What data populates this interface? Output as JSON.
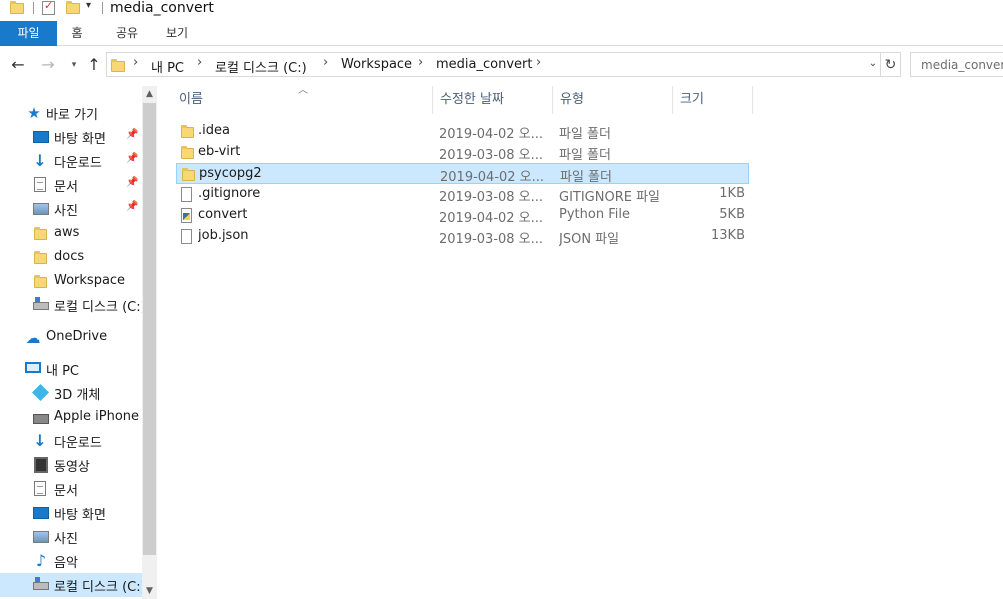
{
  "window": {
    "title": "media_convert"
  },
  "ribbon": {
    "tabs": [
      "파일",
      "홈",
      "공유",
      "보기"
    ]
  },
  "address": {
    "crumbs": [
      "내 PC",
      "로컬 디스크 (C:)",
      "Workspace",
      "media_convert"
    ]
  },
  "search": {
    "placeholder": "media_convert 검색"
  },
  "sidebar": {
    "items": [
      {
        "label": "바로 가기",
        "icon": "star-icon"
      },
      {
        "label": "바탕 화면",
        "icon": "desktop-icon",
        "pinned": true
      },
      {
        "label": "다운로드",
        "icon": "download-icon",
        "pinned": true
      },
      {
        "label": "문서",
        "icon": "document-icon",
        "pinned": true
      },
      {
        "label": "사진",
        "icon": "pictures-icon",
        "pinned": true
      },
      {
        "label": "aws",
        "icon": "folder-icon"
      },
      {
        "label": "docs",
        "icon": "folder-icon"
      },
      {
        "label": "Workspace",
        "icon": "folder-icon"
      },
      {
        "label": "로컬 디스크 (C:)",
        "icon": "drive-icon"
      },
      {
        "label": "OneDrive",
        "icon": "cloud-icon"
      },
      {
        "label": "내 PC",
        "icon": "pc-icon"
      },
      {
        "label": "3D 개체",
        "icon": "3d-objects-icon"
      },
      {
        "label": "Apple iPhone",
        "icon": "phone-icon"
      },
      {
        "label": "다운로드",
        "icon": "download-icon"
      },
      {
        "label": "동영상",
        "icon": "video-icon"
      },
      {
        "label": "문서",
        "icon": "document-icon"
      },
      {
        "label": "바탕 화면",
        "icon": "desktop-icon"
      },
      {
        "label": "사진",
        "icon": "pictures-icon"
      },
      {
        "label": "음악",
        "icon": "music-icon"
      },
      {
        "label": "로컬 디스크 (C:)",
        "icon": "drive-icon",
        "selected": true
      }
    ]
  },
  "columns": {
    "name": "이름",
    "date": "수정한 날짜",
    "type": "유형",
    "size": "크기"
  },
  "files": [
    {
      "name": ".idea",
      "date": "2019-04-02 오...",
      "type": "파일 폴더",
      "size": "",
      "icon": "folder-icon"
    },
    {
      "name": "eb-virt",
      "date": "2019-03-08 오...",
      "type": "파일 폴더",
      "size": "",
      "icon": "folder-icon"
    },
    {
      "name": "psycopg2",
      "date": "2019-04-02 오...",
      "type": "파일 폴더",
      "size": "",
      "icon": "folder-icon",
      "selected": true
    },
    {
      "name": ".gitignore",
      "date": "2019-03-08 오...",
      "type": "GITIGNORE 파일",
      "size": "1KB",
      "icon": "file-icon"
    },
    {
      "name": "convert",
      "date": "2019-04-02 오...",
      "type": "Python File",
      "size": "5KB",
      "icon": "python-file-icon"
    },
    {
      "name": "job.json",
      "date": "2019-03-08 오...",
      "type": "JSON 파일",
      "size": "13KB",
      "icon": "file-icon"
    }
  ],
  "colors": {
    "accent": "#1979ca",
    "selection": "#cce8ff",
    "header_text": "#4c607a",
    "secondary_text": "#6d6d6d"
  }
}
